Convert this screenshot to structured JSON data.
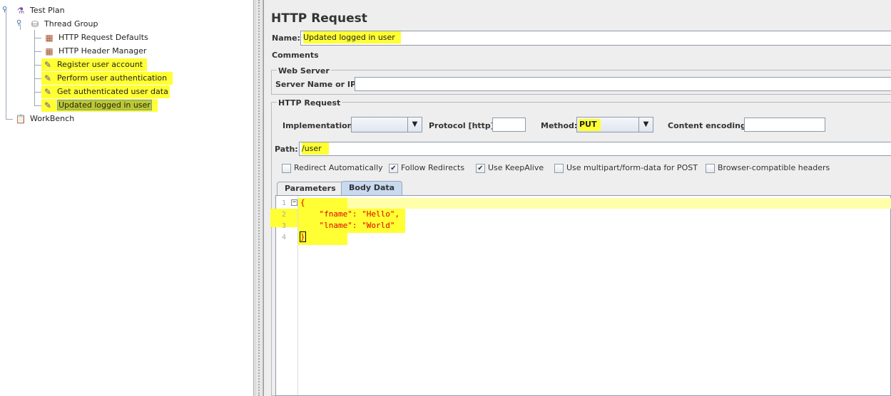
{
  "tree": {
    "items": [
      {
        "label": "Test Plan",
        "icon": "test-plan-flask-icon"
      },
      {
        "label": "Thread Group",
        "icon": "thread-group-spool-icon"
      },
      {
        "label": "HTTP Request Defaults",
        "icon": "config-element-icon"
      },
      {
        "label": "HTTP Header Manager",
        "icon": "config-element-icon"
      },
      {
        "label": "Register user account",
        "icon": "sampler-pipette-icon"
      },
      {
        "label": "Perform user authentication",
        "icon": "sampler-pipette-icon"
      },
      {
        "label": "Get authenticated user data",
        "icon": "sampler-pipette-icon"
      },
      {
        "label": "Updated logged in user",
        "icon": "sampler-pipette-icon"
      },
      {
        "label": "WorkBench",
        "icon": "workbench-clipboard-icon"
      }
    ]
  },
  "panel": {
    "title": "HTTP Request",
    "name_label": "Name:",
    "name_value": "Updated logged in user",
    "comments_label": "Comments:",
    "web_server": {
      "title": "Web Server",
      "server_label": "Server Name or IP:",
      "server_value": ""
    },
    "http_request": {
      "title": "HTTP Request",
      "implementation_label": "Implementation:",
      "implementation_value": "",
      "protocol_label": "Protocol [http]:",
      "protocol_value": "",
      "method_label": "Method:",
      "method_value": "PUT",
      "encoding_label": "Content encoding:",
      "encoding_value": "",
      "path_label": "Path:",
      "path_value": "/user"
    },
    "options": [
      {
        "label": "Redirect Automatically",
        "checked": false
      },
      {
        "label": "Follow Redirects",
        "checked": true
      },
      {
        "label": "Use KeepAlive",
        "checked": true
      },
      {
        "label": "Use multipart/form-data for POST",
        "checked": false
      },
      {
        "label": "Browser-compatible headers",
        "checked": false
      }
    ],
    "tabs": [
      {
        "label": "Parameters",
        "active": false
      },
      {
        "label": "Body Data",
        "active": true
      }
    ],
    "body_lines": [
      {
        "n": "1",
        "text": "{"
      },
      {
        "n": "2",
        "text": "    \"fname\": \"Hello\","
      },
      {
        "n": "3",
        "text": "    \"lname\": \"World\""
      },
      {
        "n": "4",
        "text": "}"
      }
    ],
    "colors": {
      "highlight": "#ffff33",
      "code": "#e00000",
      "current_line": "#ffffaa"
    }
  }
}
